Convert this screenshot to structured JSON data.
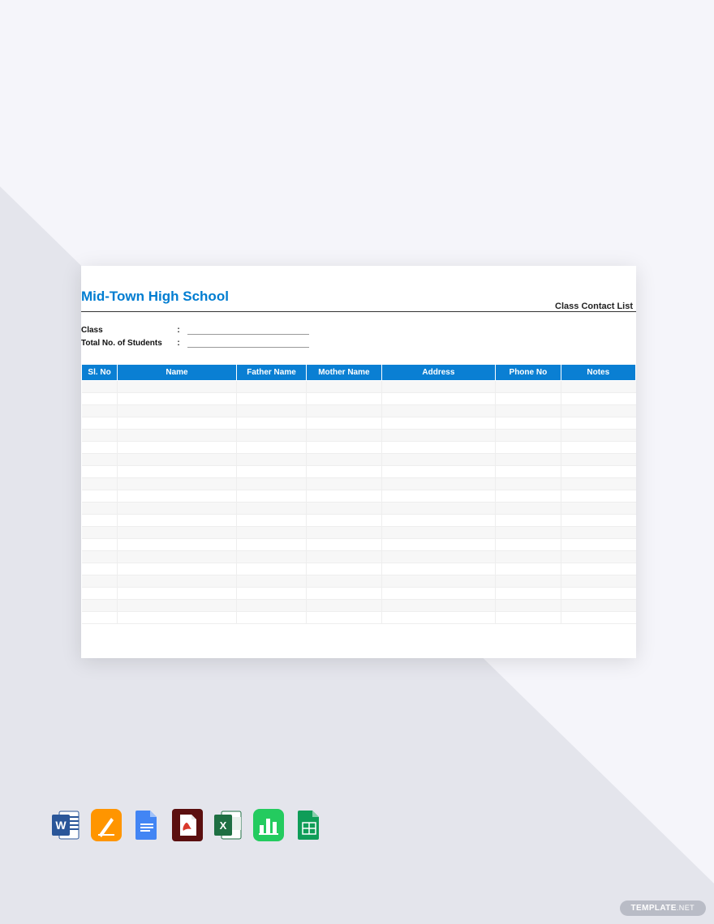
{
  "document": {
    "school_name": "Mid-Town High School",
    "subtitle": "Class Contact List",
    "fields": {
      "class_label": "Class",
      "total_label": "Total No. of Students",
      "colon": ":"
    },
    "columns": [
      "Sl. No",
      "Name",
      "Father Name",
      "Mother Name",
      "Address",
      "Phone No",
      "Notes"
    ],
    "row_count": 20
  },
  "watermark": {
    "brand": "TEMPLATE",
    "suffix": ".NET"
  }
}
